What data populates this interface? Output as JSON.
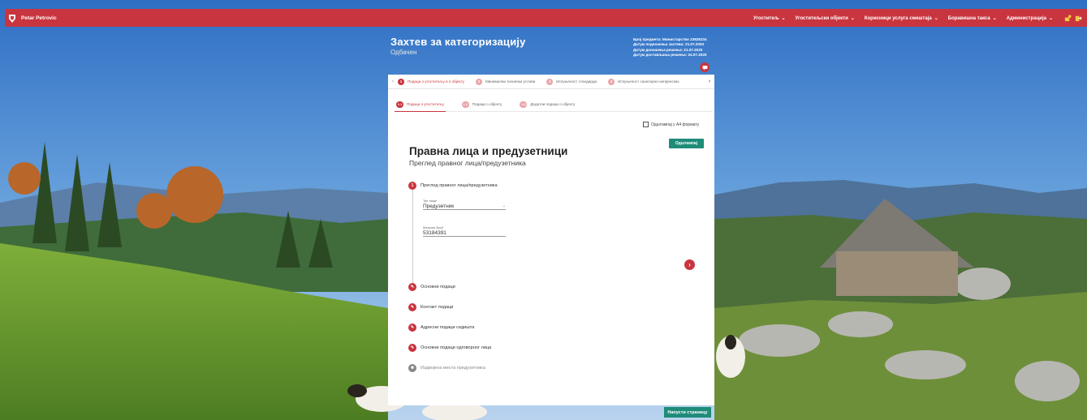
{
  "topbar": {
    "user": "Petar Petrovic",
    "nav": [
      {
        "label": "Угоститељ"
      },
      {
        "label": "Угоститељски објекти"
      },
      {
        "label": "Корисници услуга смештаја"
      },
      {
        "label": "Боравишна такса"
      },
      {
        "label": "Администрација"
      }
    ]
  },
  "header": {
    "title": "Захтев за категоризацију",
    "status": "Одбачен",
    "meta": [
      "Број предмета: Министарство 23828234",
      "Датум подношења захтева: 21.07.2020",
      "Датум доношења решења: 21.07.2020",
      "Датум достављања решења: 24.07.2020"
    ]
  },
  "steps": [
    {
      "num": "1",
      "label": "Подаци о угоститељу и о објекту"
    },
    {
      "num": "2",
      "label": "Минимални технички услови"
    },
    {
      "num": "3",
      "label": "Испуњеност стандарда"
    },
    {
      "num": "4",
      "label": "Испуњеност санитарно-хигијенских"
    }
  ],
  "substeps": [
    {
      "num": "1.1",
      "label": "Подаци о угоститељу"
    },
    {
      "num": "1.2",
      "label": "Подаци о објекту"
    },
    {
      "num": "1.3",
      "label": "Додатни подаци о објекту"
    }
  ],
  "print": {
    "checkbox_label": "Одштампај у A4 формату",
    "button_label": "Одштампај"
  },
  "content": {
    "title": "Правна лица и предузетници",
    "subtitle": "Преглед правног лица/предузетника"
  },
  "sections": [
    {
      "num": "1",
      "label": "Преглед правног лица/предузетника"
    },
    {
      "label": "Основни подаци"
    },
    {
      "label": "Контакт подаци"
    },
    {
      "label": "Адресни подаци седишта"
    },
    {
      "label": "Основни подаци одговорног лица"
    },
    {
      "label": "Издвојена места предузетника"
    }
  ],
  "fields": {
    "type_label": "Тип лица*",
    "type_value": "Предузетник",
    "mb_label": "Матични број*",
    "mb_value": "53184391"
  },
  "footer": {
    "leave_label": "Напусти страницу"
  },
  "colors": {
    "accent": "#c9353e",
    "primary_button": "#1e8c79"
  }
}
